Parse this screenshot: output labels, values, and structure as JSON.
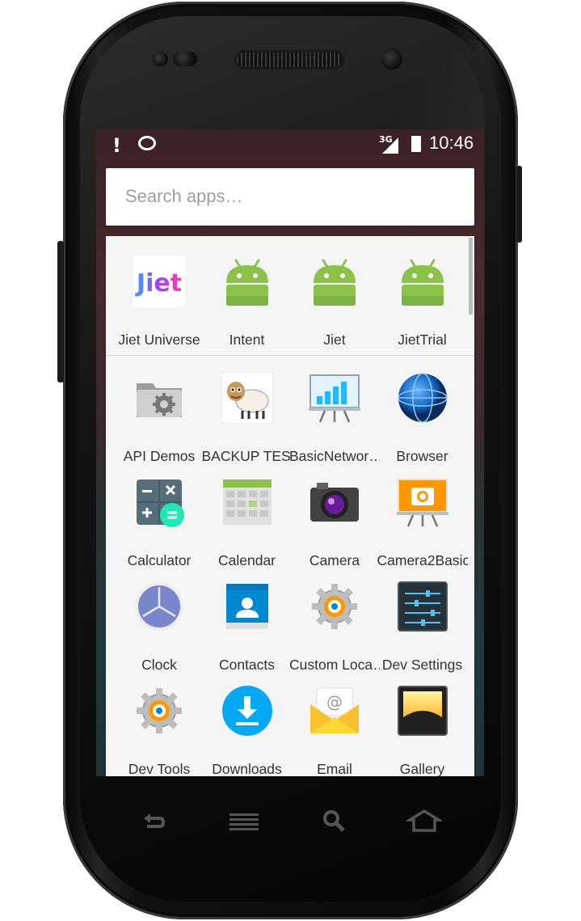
{
  "status_bar": {
    "alert": "!",
    "network": "3G",
    "time": "10:46"
  },
  "search": {
    "placeholder": "Search apps…"
  },
  "pinned_apps": [
    {
      "label": "Jiet Universe",
      "icon": "jiet-logo-icon"
    },
    {
      "label": "Intent",
      "icon": "android-icon"
    },
    {
      "label": "Jiet",
      "icon": "android-icon"
    },
    {
      "label": "JietTrial",
      "icon": "android-icon"
    }
  ],
  "apps": [
    {
      "label": "API Demos",
      "icon": "folder-gear-icon"
    },
    {
      "label": "BACKUP TEST",
      "icon": "sheep-icon"
    },
    {
      "label": "BasicNetwor…",
      "icon": "presentation-chart-icon"
    },
    {
      "label": "Browser",
      "icon": "globe-icon"
    },
    {
      "label": "Calculator",
      "icon": "calculator-icon"
    },
    {
      "label": "Calendar",
      "icon": "calendar-icon"
    },
    {
      "label": "Camera",
      "icon": "camera-icon"
    },
    {
      "label": "Camera2Basic",
      "icon": "camera-easel-icon"
    },
    {
      "label": "Clock",
      "icon": "clock-icon"
    },
    {
      "label": "Contacts",
      "icon": "contacts-icon"
    },
    {
      "label": "Custom Loca…",
      "icon": "gear-icon"
    },
    {
      "label": "Dev Settings",
      "icon": "sliders-icon"
    },
    {
      "label": "Dev Tools",
      "icon": "gear-icon"
    },
    {
      "label": "Downloads",
      "icon": "download-icon"
    },
    {
      "label": "Email",
      "icon": "email-envelope-icon"
    },
    {
      "label": "Gallery",
      "icon": "gallery-icon"
    }
  ],
  "nav_buttons": [
    {
      "icon": "back-icon"
    },
    {
      "icon": "menu-icon"
    },
    {
      "icon": "search-icon"
    },
    {
      "icon": "home-icon"
    }
  ],
  "jiet_logo_text": "Jiet"
}
